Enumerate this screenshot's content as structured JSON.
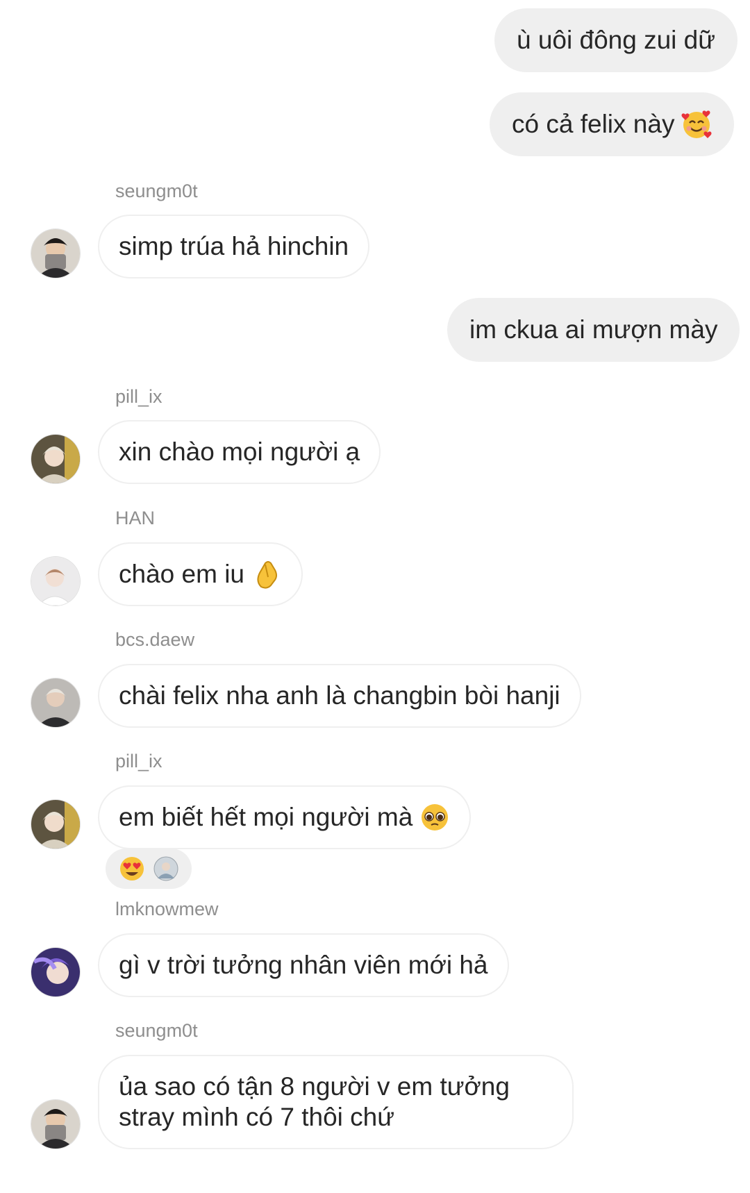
{
  "messages": [
    {
      "type": "outgoing",
      "text": "ù uôi đông zui dữ"
    },
    {
      "type": "outgoing",
      "text": "có cả felix này",
      "emoji": "smiling-face-with-hearts"
    },
    {
      "type": "incoming",
      "sender": "seungm0t",
      "text": "simp trúa hả hinchin"
    },
    {
      "type": "outgoing",
      "text": "im ckua ai mượn mày"
    },
    {
      "type": "incoming",
      "sender": "pill_ix",
      "text": "xin chào mọi người ạ"
    },
    {
      "type": "incoming",
      "sender": "HAN",
      "text": "chào em iu",
      "emoji": "pinched-fingers"
    },
    {
      "type": "incoming",
      "sender": "bcs.daew",
      "text": "chài felix nha anh là changbin bòi hanji"
    },
    {
      "type": "incoming",
      "sender": "pill_ix",
      "text": "em biết hết mọi người mà",
      "emoji": "pleading-face",
      "reactions": [
        "heart-eyes-emoji",
        "reactor-avatar"
      ]
    },
    {
      "type": "incoming",
      "sender": "lmknowmew",
      "text": "gì v trời tưởng nhân viên mới hả"
    },
    {
      "type": "incoming",
      "sender": "seungm0t",
      "text": "ủa sao có tận 8 người v em tưởng stray mình có 7 thôi chứ"
    }
  ],
  "colors": {
    "outgoing_bubble": "#efefef",
    "incoming_border": "#efefef",
    "sender_text": "#8e8e8e",
    "text": "#262626"
  }
}
